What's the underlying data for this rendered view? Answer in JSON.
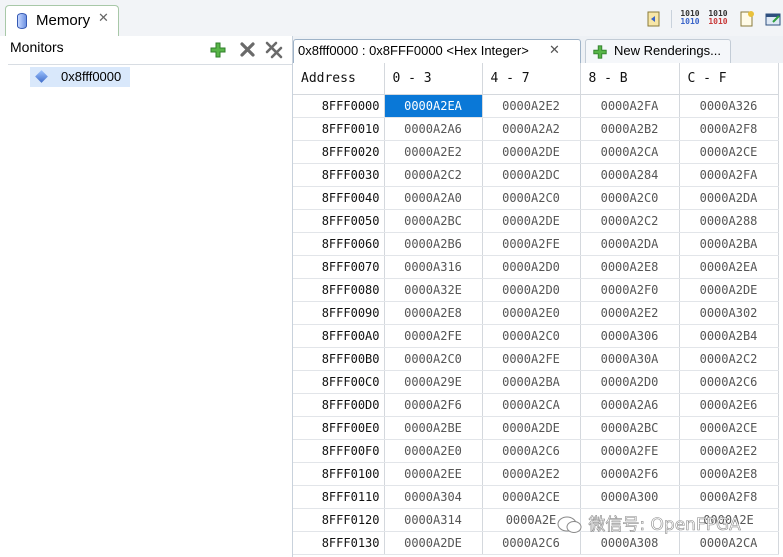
{
  "view": {
    "tab_title": "Memory",
    "close_glyph": "✕"
  },
  "toolbar": {
    "icons": [
      "import-memory-icon",
      "hex-rendering-icon",
      "binary-rendering-icon",
      "export-memory-icon",
      "new-window-icon"
    ],
    "bits_label": "1010"
  },
  "monitors": {
    "label": "Monitors",
    "buttons": [
      "add-monitor-icon",
      "remove-monitor-icon",
      "remove-all-monitors-icon"
    ],
    "items": [
      {
        "label": "0x8fff0000"
      }
    ]
  },
  "renderings": {
    "active_tab_label": "0x8fff0000 : 0x8FFF0000 <Hex Integer>",
    "new_tab_label": "New Renderings..."
  },
  "memory": {
    "headers": [
      "Address",
      "0 - 3",
      "4 - 7",
      "8 - B",
      "C - F"
    ],
    "selected": {
      "row": 0,
      "col": 0
    },
    "rows": [
      {
        "addr": "8FFF0000",
        "cells": [
          "0000A2EA",
          "0000A2E2",
          "0000A2FA",
          "0000A326"
        ]
      },
      {
        "addr": "8FFF0010",
        "cells": [
          "0000A2A6",
          "0000A2A2",
          "0000A2B2",
          "0000A2F8"
        ]
      },
      {
        "addr": "8FFF0020",
        "cells": [
          "0000A2E2",
          "0000A2DE",
          "0000A2CA",
          "0000A2CE"
        ]
      },
      {
        "addr": "8FFF0030",
        "cells": [
          "0000A2C2",
          "0000A2DC",
          "0000A284",
          "0000A2FA"
        ]
      },
      {
        "addr": "8FFF0040",
        "cells": [
          "0000A2A0",
          "0000A2C0",
          "0000A2C0",
          "0000A2DA"
        ]
      },
      {
        "addr": "8FFF0050",
        "cells": [
          "0000A2BC",
          "0000A2DE",
          "0000A2C2",
          "0000A288"
        ]
      },
      {
        "addr": "8FFF0060",
        "cells": [
          "0000A2B6",
          "0000A2FE",
          "0000A2DA",
          "0000A2BA"
        ]
      },
      {
        "addr": "8FFF0070",
        "cells": [
          "0000A316",
          "0000A2D0",
          "0000A2E8",
          "0000A2EA"
        ]
      },
      {
        "addr": "8FFF0080",
        "cells": [
          "0000A32E",
          "0000A2D0",
          "0000A2F0",
          "0000A2DE"
        ]
      },
      {
        "addr": "8FFF0090",
        "cells": [
          "0000A2E8",
          "0000A2E0",
          "0000A2E2",
          "0000A302"
        ]
      },
      {
        "addr": "8FFF00A0",
        "cells": [
          "0000A2FE",
          "0000A2C0",
          "0000A306",
          "0000A2B4"
        ]
      },
      {
        "addr": "8FFF00B0",
        "cells": [
          "0000A2C0",
          "0000A2FE",
          "0000A30A",
          "0000A2C2"
        ]
      },
      {
        "addr": "8FFF00C0",
        "cells": [
          "0000A29E",
          "0000A2BA",
          "0000A2D0",
          "0000A2C6"
        ]
      },
      {
        "addr": "8FFF00D0",
        "cells": [
          "0000A2F6",
          "0000A2CA",
          "0000A2A6",
          "0000A2E6"
        ]
      },
      {
        "addr": "8FFF00E0",
        "cells": [
          "0000A2BE",
          "0000A2DE",
          "0000A2BC",
          "0000A2CE"
        ]
      },
      {
        "addr": "8FFF00F0",
        "cells": [
          "0000A2E0",
          "0000A2C6",
          "0000A2FE",
          "0000A2E2"
        ]
      },
      {
        "addr": "8FFF0100",
        "cells": [
          "0000A2EE",
          "0000A2E2",
          "0000A2F6",
          "0000A2E8"
        ]
      },
      {
        "addr": "8FFF0110",
        "cells": [
          "0000A304",
          "0000A2CE",
          "0000A300",
          "0000A2F8"
        ]
      },
      {
        "addr": "8FFF0120",
        "cells": [
          "0000A314",
          "0000A2E",
          "",
          "0000A2E"
        ]
      },
      {
        "addr": "8FFF0130",
        "cells": [
          "0000A2DE",
          "0000A2C6",
          "0000A308",
          "0000A2CA"
        ]
      }
    ]
  },
  "watermark": {
    "text": "微信号: OpenFPGA"
  },
  "colors": {
    "selection": "#0a78d7",
    "accent_green": "#3aa335"
  }
}
